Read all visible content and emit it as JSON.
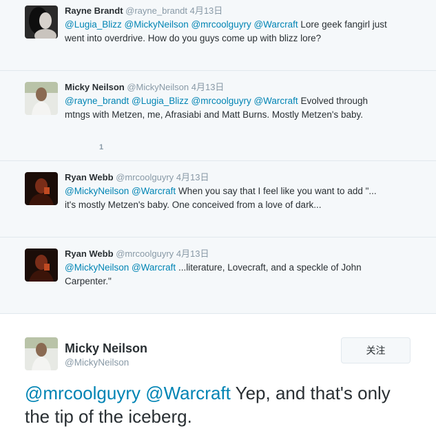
{
  "tweets": [
    {
      "name": "Rayne Brandt",
      "handle": "@rayne_brandt",
      "time": "4月13日",
      "mentions": "@Lugia_Blizz @MickyNeilson @mrcoolguyry @Warcraft",
      "text": " Lore geek fangirl just went into overdrive. How do you guys come up with blizz lore?"
    },
    {
      "name": "Micky Neilson",
      "handle": "@MickyNeilson",
      "time": "4月13日",
      "mentions": "@rayne_brandt @Lugia_Blizz @mrcoolguyry @Warcraft",
      "text": " Evolved through mtngs with Metzen, me, Afrasiabi and Matt Burns. Mostly Metzen's baby.",
      "count": "1"
    },
    {
      "name": "Ryan Webb",
      "handle": "@mrcoolguyry",
      "time": "4月13日",
      "mentions": "@MickyNeilson @Warcraft",
      "text": " When you say that I feel like you want to add \"... it's mostly Metzen's baby. One conceived from a love of dark..."
    },
    {
      "name": "Ryan Webb",
      "handle": "@mrcoolguyry",
      "time": "4月13日",
      "mentions": "@MickyNeilson @Warcraft",
      "text": " ...literature, Lovecraft, and a speckle of John Carpenter.\""
    }
  ],
  "focused": {
    "name": "Micky Neilson",
    "handle": "@MickyNeilson",
    "follow_label": "关注",
    "mentions": "@mrcoolguyry @Warcraft",
    "text": " Yep, and that's only the tip of the iceberg."
  },
  "colors": {
    "link": "#0084b4",
    "thread_bg": "#f5f8fa",
    "meta": "#8899a6"
  }
}
